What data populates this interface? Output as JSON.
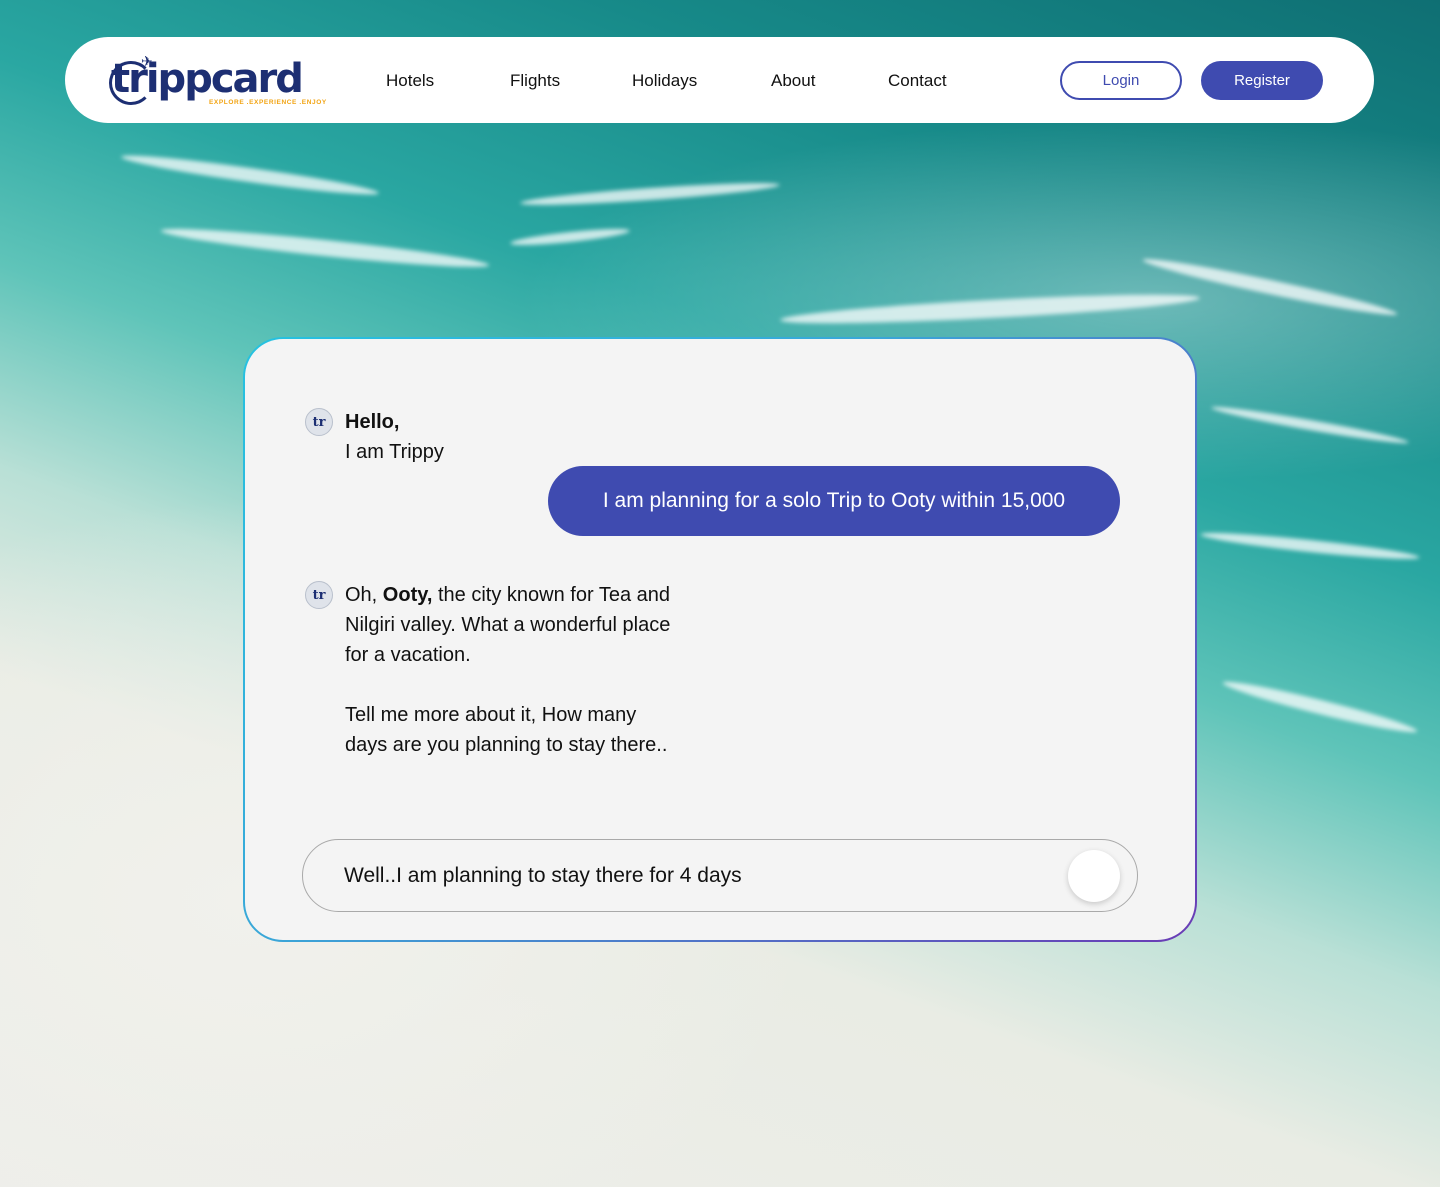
{
  "brand": {
    "logo_text": "trippcard",
    "tagline": "EXPLORE .EXPERIENCE .ENJOY"
  },
  "nav": {
    "links": [
      "Hotels",
      "Flights",
      "Holidays",
      "About",
      "Contact"
    ],
    "login_label": "Login",
    "register_label": "Register"
  },
  "chat": {
    "bot_avatar_text": "tr",
    "greeting_title": "Hello,",
    "greeting_line": "I am Trippy",
    "user_message": "I am planning for a solo Trip to Ooty within 15,000",
    "reply_prefix": "Oh, ",
    "reply_bold": "Ooty,",
    "reply_rest_1": " the city known for Tea and",
    "reply_line_2": "Nilgiri valley. What a wonderful place",
    "reply_line_3": "for a vacation.",
    "reply_line_4": "Tell me more about it, How many",
    "reply_line_5": "days are you planning to stay there..",
    "input_value": "Well..I am planning to stay there for 4 days"
  },
  "colors": {
    "brand_blue": "#3f4bb0",
    "logo_navy": "#1d2f73",
    "tagline_orange": "#f2a413"
  },
  "icons": {
    "send": "send-icon",
    "bot_avatar": "trippy-avatar-icon",
    "logo_plane": "plane-icon"
  }
}
